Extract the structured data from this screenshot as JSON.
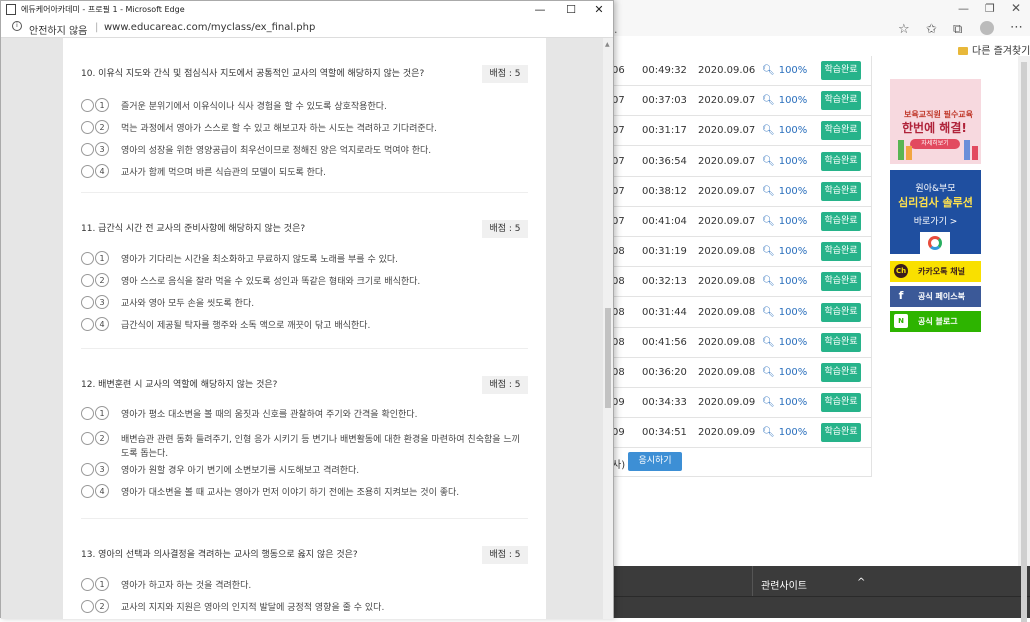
{
  "background": {
    "address_tail": ".",
    "favorites_label": "다른 즐겨찾기",
    "table_rows": [
      {
        "n": "06",
        "time": "00:49:32",
        "date": "2020.09.06",
        "pct": "100%",
        "btn": "학습완료"
      },
      {
        "n": "07",
        "time": "00:37:03",
        "date": "2020.09.07",
        "pct": "100%",
        "btn": "학습완료"
      },
      {
        "n": "07",
        "time": "00:31:17",
        "date": "2020.09.07",
        "pct": "100%",
        "btn": "학습완료"
      },
      {
        "n": "07",
        "time": "00:36:54",
        "date": "2020.09.07",
        "pct": "100%",
        "btn": "학습완료"
      },
      {
        "n": "07",
        "time": "00:38:12",
        "date": "2020.09.07",
        "pct": "100%",
        "btn": "학습완료"
      },
      {
        "n": "07",
        "time": "00:41:04",
        "date": "2020.09.07",
        "pct": "100%",
        "btn": "학습완료"
      },
      {
        "n": "08",
        "time": "00:31:19",
        "date": "2020.09.08",
        "pct": "100%",
        "btn": "학습완료"
      },
      {
        "n": "08",
        "time": "00:32:13",
        "date": "2020.09.08",
        "pct": "100%",
        "btn": "학습완료"
      },
      {
        "n": "08",
        "time": "00:31:44",
        "date": "2020.09.08",
        "pct": "100%",
        "btn": "학습완료"
      },
      {
        "n": "08",
        "time": "00:41:56",
        "date": "2020.09.08",
        "pct": "100%",
        "btn": "학습완료"
      },
      {
        "n": "08",
        "time": "00:36:20",
        "date": "2020.09.08",
        "pct": "100%",
        "btn": "학습완료"
      },
      {
        "n": "09",
        "time": "00:34:33",
        "date": "2020.09.09",
        "pct": "100%",
        "btn": "학습완료"
      },
      {
        "n": "09",
        "time": "00:34:51",
        "date": "2020.09.09",
        "pct": "100%",
        "btn": "학습완료"
      }
    ],
    "paren_text": "사)",
    "apply_button": "응시하기",
    "ad_banner_1": {
      "line1": "보육교직원 필수교육",
      "line2": "한번에 해결!",
      "button": "자세히보기"
    },
    "ad_banner_2": {
      "line1": "원아&부모",
      "line2": "심리검사 솔루션",
      "line3": "바로가기 >"
    },
    "social": {
      "kakao": {
        "icon": "Ch",
        "label": "카카오톡 채널"
      },
      "facebook": {
        "icon": "f",
        "label": "공식 페이스북"
      },
      "blog": {
        "icon": "N",
        "label": "공식 블로그"
      }
    },
    "footer_label": "관련사이트",
    "footer_arrow": "^"
  },
  "popup": {
    "window_title": "에듀케어아카데미 - 프로필 1 - Microsoft Edge",
    "insecure_label": "안전하지 않음",
    "separator": "|",
    "url": "www.educareac.com/myclass/ex_final.php",
    "questions": [
      {
        "title": "10. 이유식 지도와 간식 및 점심식사 지도에서 공통적인 교사의 역할에 해당하지 않는 것은?",
        "score": "배점 : 5",
        "options": [
          {
            "num": "1",
            "text": "즐거운 분위기에서 이유식이나 식사 경험을 할 수 있도록 상호작용한다."
          },
          {
            "num": "2",
            "text": "먹는 과정에서 영아가 스스로 할 수 있고 해보고자 하는 시도는 격려하고 기다려준다."
          },
          {
            "num": "3",
            "text": "영아의 성장을 위한 영양공급이 최우선이므로 정해진 양은 억지로라도 먹여야 한다."
          },
          {
            "num": "4",
            "text": "교사가 함께 먹으며 바른 식습관의 모델이 되도록 한다."
          }
        ]
      },
      {
        "title": "11. 급간식 시간 전 교사의 준비사항에 해당하지 않는 것은?",
        "score": "배점 : 5",
        "options": [
          {
            "num": "1",
            "text": "영아가 기다리는 시간을 최소화하고 무료하지 않도록 노래를 부를 수 있다."
          },
          {
            "num": "2",
            "text": "영아 스스로 음식을 잘라 먹을 수 있도록 성인과 똑같은 형태와 크기로 배식한다."
          },
          {
            "num": "3",
            "text": "교사와 영아 모두 손을 씻도록 한다."
          },
          {
            "num": "4",
            "text": "급간식이 제공될 탁자를 행주와 소독 액으로 깨끗이 닦고 배식한다."
          }
        ]
      },
      {
        "title": "12. 배변훈련 시 교사의 역할에 해당하지 않는 것은?",
        "score": "배점 : 5",
        "options": [
          {
            "num": "1",
            "text": "영아가 평소 대소변을 볼 때의 움짓과 신호를 관찰하여 주기와 간격을 확인한다."
          },
          {
            "num": "2",
            "text": "배변습관 관련 동화 들려주기, 인형 응가 시키기 등 변기나 배변활동에 대한 환경을 마련하여 친숙함을 느끼도록 돕는다."
          },
          {
            "num": "3",
            "text": "영아가 원할 경우 아기 변기에 소변보기를 시도해보고 격려한다."
          },
          {
            "num": "4",
            "text": "영아가 대소변을 볼 때 교사는 영아가 먼저 이야기 하기 전에는 조용히 지켜보는 것이 좋다."
          }
        ]
      },
      {
        "title": "13. 영아의 선택과 의사결정을 격려하는 교사의 행동으로 옳지 않은 것은?",
        "score": "배점 : 5",
        "options": [
          {
            "num": "1",
            "text": "영아가 하고자 하는 것을 격려한다."
          },
          {
            "num": "2",
            "text": "교사의 지지와 지원은 영아의 인지적 발달에 긍정적 영향을 줄 수 있다."
          }
        ]
      }
    ]
  }
}
